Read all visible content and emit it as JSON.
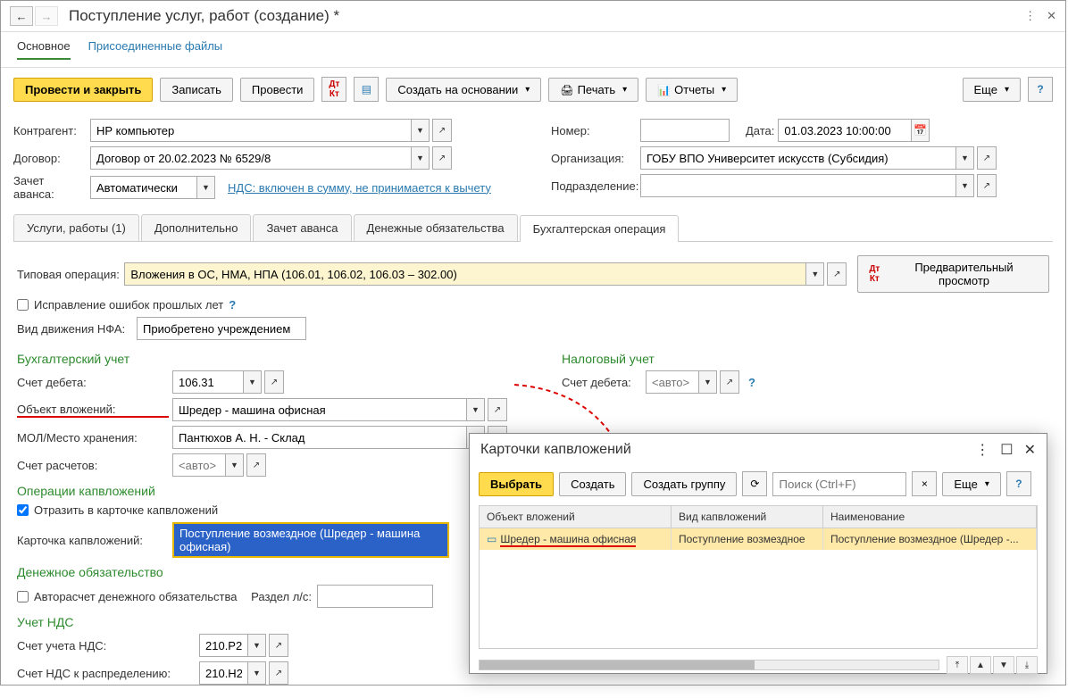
{
  "window": {
    "title": "Поступление услуг, работ (создание) *"
  },
  "topnav": {
    "main": "Основное",
    "files": "Присоединенные файлы"
  },
  "toolbar": {
    "post_close": "Провести и закрыть",
    "save": "Записать",
    "post": "Провести",
    "create_based": "Создать на основании",
    "print": "Печать",
    "reports": "Отчеты",
    "more": "Еще"
  },
  "form": {
    "contractor_label": "Контрагент:",
    "contractor": "НР компьютер",
    "number_label": "Номер:",
    "number": "",
    "date_label": "Дата:",
    "date": "01.03.2023 10:00:00",
    "contract_label": "Договор:",
    "contract": "Договор от 20.02.2023 № 6529/8",
    "org_label": "Организация:",
    "org": "ГОБУ ВПО Университет искусств (Субсидия)",
    "advance_label": "Зачет аванса:",
    "advance": "Автоматически",
    "vat_link": "НДС: включен в сумму, не принимается к вычету",
    "dept_label": "Подразделение:",
    "dept": ""
  },
  "tabs": {
    "t1": "Услуги, работы (1)",
    "t2": "Дополнительно",
    "t3": "Зачет аванса",
    "t4": "Денежные обязательства",
    "t5": "Бухгалтерская операция"
  },
  "bookkeeping": {
    "typical_label": "Типовая операция:",
    "typical": "Вложения в ОС, НМА, НПА (106.01, 106.02, 106.03 – 302.00)",
    "preview": "Предварительный просмотр",
    "errors_fix": "Исправление ошибок прошлых лет",
    "nfa_label": "Вид движения НФА:",
    "nfa": "Приобретено учреждением",
    "accounting_title": "Бухгалтерский учет",
    "tax_title": "Налоговый учет",
    "debit_label": "Счет дебета:",
    "debit": "106.31",
    "tax_debit_label": "Счет дебета:",
    "tax_debit_placeholder": "<авто>",
    "object_label": "Объект вложений:",
    "object": "Шредер - машина офисная",
    "mol_label": "МОЛ/Место хранения:",
    "mol": "Пантюхов А. Н. - Склад",
    "settlement_label": "Счет расчетов:",
    "settlement_placeholder": "<авто>",
    "capops_title": "Операции капвложений",
    "reflect": "Отразить в карточке капвложений",
    "card_label": "Карточка капвложений:",
    "card": "Поступление возмездное (Шредер - машина офисная)",
    "money_title": "Денежное обязательство",
    "autocalc": "Авторасчет денежного обязательства",
    "section_label": "Раздел л/с:",
    "vat_title": "Учет НДС",
    "vat_account_label": "Счет учета НДС:",
    "vat_account": "210.Р2",
    "vat_dist_label": "Счет НДС к распределению:",
    "vat_dist": "210.Н2"
  },
  "popup": {
    "title": "Карточки капвложений",
    "select": "Выбрать",
    "create": "Создать",
    "create_group": "Создать группу",
    "search_placeholder": "Поиск (Ctrl+F)",
    "more": "Еще",
    "col1": "Объект вложений",
    "col2": "Вид капвложений",
    "col3": "Наименование",
    "row1_obj": "Шредер - машина офисная",
    "row1_type": "Поступление возмездное",
    "row1_name": "Поступление возмездное (Шредер -..."
  }
}
